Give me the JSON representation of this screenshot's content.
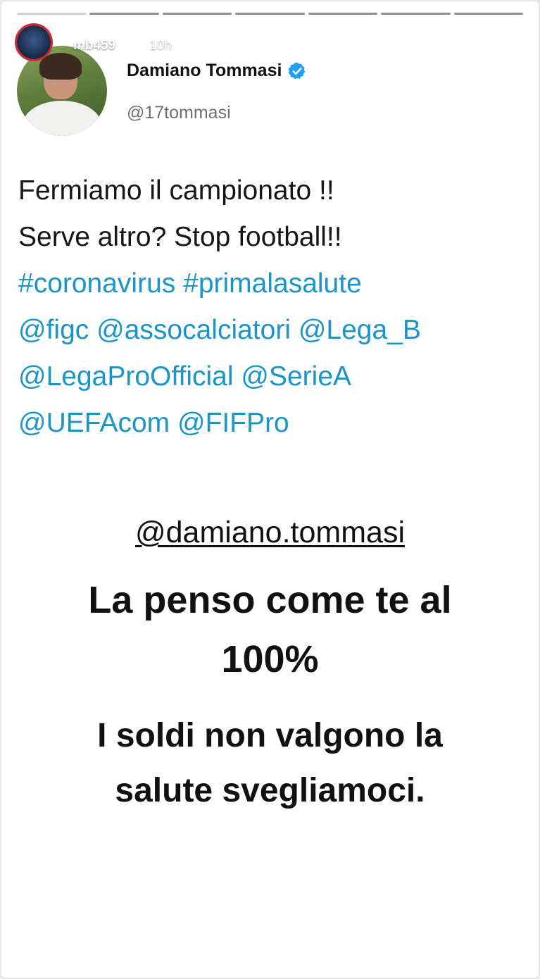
{
  "story": {
    "username": "mb459",
    "time_ago": "10h",
    "close_icon": "close-icon"
  },
  "tweet": {
    "display_name": "Damiano Tommasi",
    "handle": "@17tommasi",
    "verified": true,
    "lines": [
      "Fermiamo il campionato !!",
      "Serve altro? Stop football!!"
    ],
    "hashtags": [
      "#coronavirus",
      "#primalasalute"
    ],
    "mentions": [
      "@figc",
      "@assocalciatori",
      "@Lega_B",
      "@LegaProOfficial",
      "@SerieA",
      "@UEFAcom",
      "@FIFPro"
    ]
  },
  "overlay": {
    "mention": "@damiano.tommasi",
    "caption_line_1": "La penso come te al",
    "caption_line_2": "100%",
    "caption_line_3": "I soldi non valgono la",
    "caption_line_4": "salute svegliamoci."
  },
  "colors": {
    "link": "#1b95c8",
    "verified": "#1da1f2",
    "story_ring": "#d4262f"
  }
}
